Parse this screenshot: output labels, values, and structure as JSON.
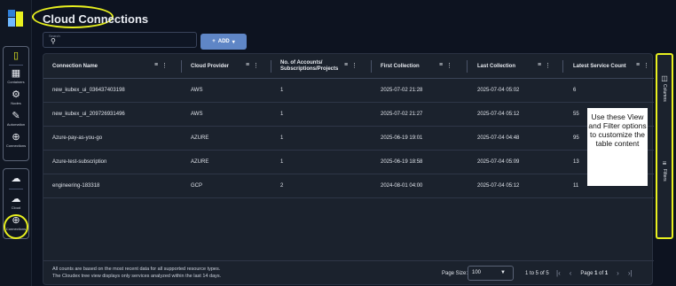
{
  "rail": {
    "items_top": [
      {
        "label": "",
        "icon": "book-icon"
      },
      {
        "label": "Containers",
        "icon": "containers-icon"
      },
      {
        "label": "Nodes",
        "icon": "nodes-icon"
      },
      {
        "label": "Automation",
        "icon": "automation-icon"
      },
      {
        "label": "Connections",
        "icon": "connections-icon"
      }
    ],
    "items_bottom": [
      {
        "label": "",
        "icon": "cloud-outline-icon"
      },
      {
        "label": "Cloud",
        "icon": "cloud-icon"
      },
      {
        "label": "Connections",
        "icon": "plus-circle-icon"
      }
    ]
  },
  "page": {
    "title": "Cloud Connections"
  },
  "search": {
    "label": "Search",
    "value": ""
  },
  "add_button": {
    "label": "ADD"
  },
  "table": {
    "columns": [
      "Connection Name",
      "Cloud Provider",
      "No. of Accounts/ Subscriptions/Projects",
      "First Collection",
      "Last Collection",
      "Latest Service Count"
    ],
    "rows": [
      [
        "new_kubex_ui_036437403198",
        "AWS",
        "1",
        "2025-07-02 21:28",
        "2025-07-04 05:02",
        "6"
      ],
      [
        "new_kubex_ui_209726931496",
        "AWS",
        "1",
        "2025-07-02 21:27",
        "2025-07-04 05:12",
        "55"
      ],
      [
        "Azure-pay-as-you-go",
        "AZURE",
        "1",
        "2025-06-19 19:01",
        "2025-07-04 04:48",
        "95"
      ],
      [
        "Azure-test-subscription",
        "AZURE",
        "1",
        "2025-06-19 18:58",
        "2025-07-04 05:09",
        "13"
      ],
      [
        "engineering-183318",
        "GCP",
        "2",
        "2024-08-01 04:00",
        "2025-07-04 05:12",
        "11"
      ]
    ]
  },
  "footer": {
    "note_line1": "All counts are based on the most recent data for all supported resource types.",
    "note_line2": "The Cloudex tree view displays only services analyzed within the last 14 days.",
    "page_size_label": "Page Size:",
    "page_size_value": "100",
    "range": "1 to 5 of 5",
    "page_prefix": "Page",
    "page_current": "1",
    "page_of": "of",
    "page_total": "1"
  },
  "side_tools": {
    "columns_label": "Columns",
    "filters_label": "Filters"
  },
  "callout": {
    "text": "Use these View and Filter options to customize the table content"
  },
  "colors": {
    "accent_yellow": "#e8f01f",
    "add_button": "#5f86c6",
    "background": "#0d1320",
    "panel": "#1b222d"
  }
}
